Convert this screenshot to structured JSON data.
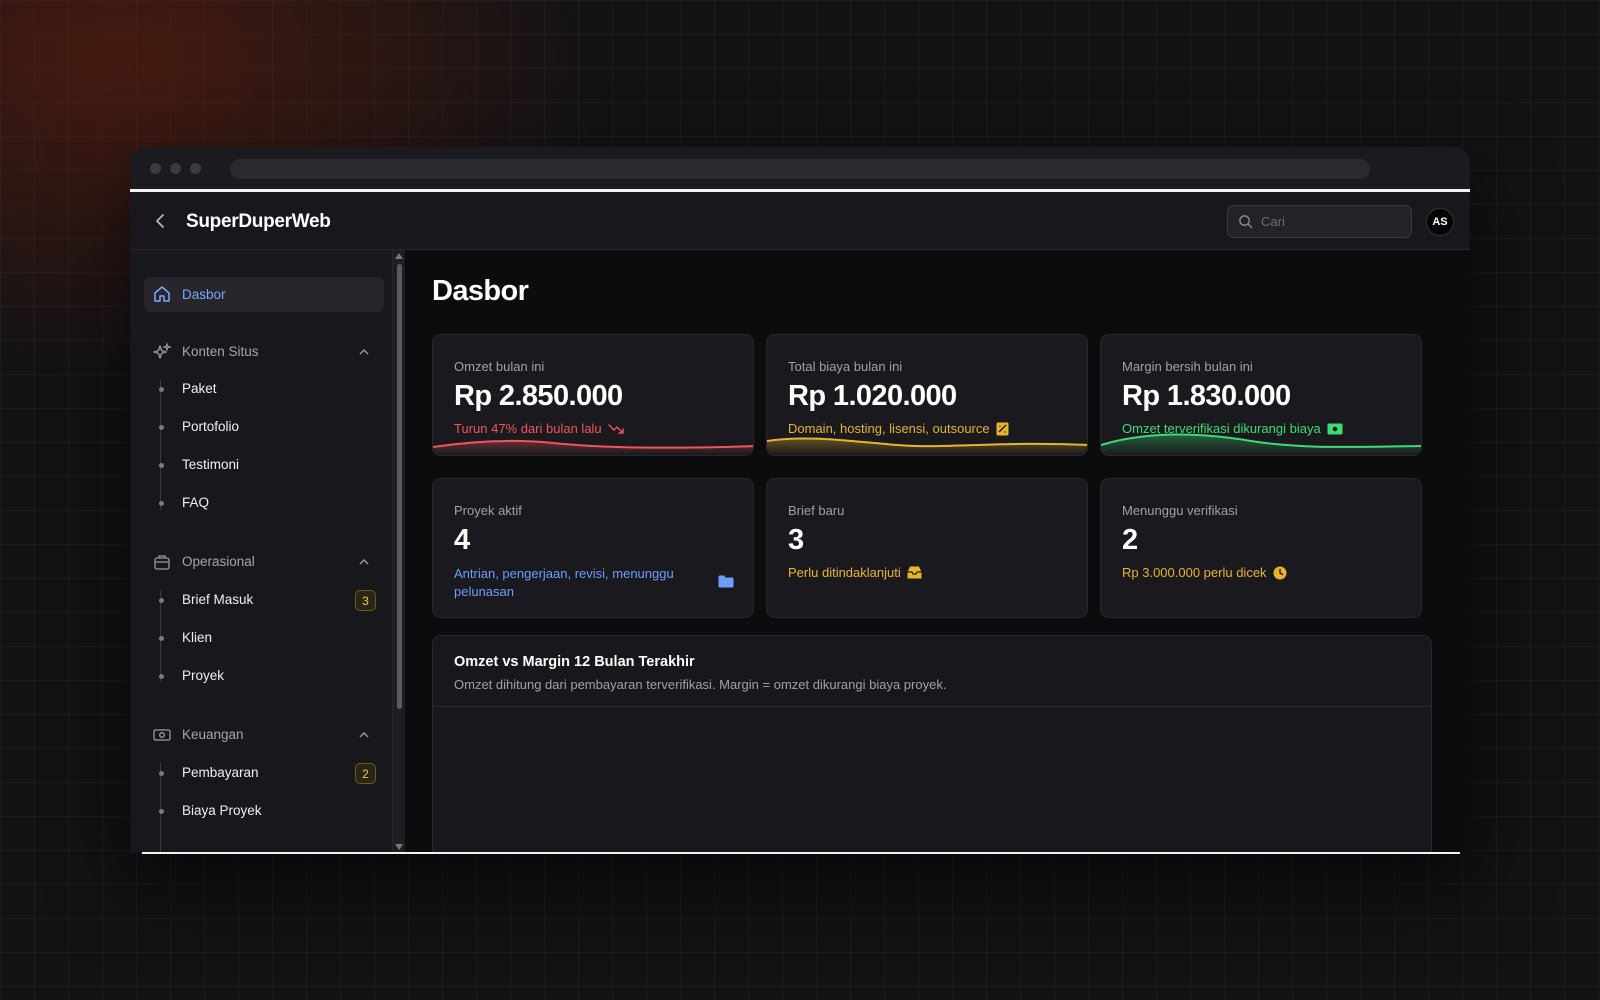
{
  "app": {
    "brand": "SuperDuperWeb",
    "search_placeholder": "Cari",
    "avatar_initials": "AS"
  },
  "sidebar": {
    "active": {
      "label": "Dasbor",
      "icon": "home-icon"
    },
    "groups": [
      {
        "label": "Konten Situs",
        "icon": "sparkles-icon",
        "items": [
          {
            "label": "Paket"
          },
          {
            "label": "Portofolio"
          },
          {
            "label": "Testimoni"
          },
          {
            "label": "FAQ"
          }
        ]
      },
      {
        "label": "Operasional",
        "icon": "briefcase-icon",
        "items": [
          {
            "label": "Brief Masuk",
            "badge": "3"
          },
          {
            "label": "Klien"
          },
          {
            "label": "Proyek"
          }
        ]
      },
      {
        "label": "Keuangan",
        "icon": "money-icon",
        "items": [
          {
            "label": "Pembayaran",
            "badge": "2"
          },
          {
            "label": "Biaya Proyek"
          }
        ]
      }
    ]
  },
  "main": {
    "title": "Dasbor",
    "cards": [
      {
        "label": "Omzet bulan ini",
        "value": "Rp 2.850.000",
        "sub": "Turun 47% dari bulan lalu",
        "color": "#f0555b",
        "icon": "trending-down-icon"
      },
      {
        "label": "Total biaya bulan ini",
        "value": "Rp 1.020.000",
        "sub": "Domain, hosting, lisensi, outsource",
        "color": "#e7b52c",
        "icon": "receipt-icon"
      },
      {
        "label": "Margin bersih bulan ini",
        "value": "Rp 1.830.000",
        "sub": "Omzet terverifikasi dikurangi biaya",
        "color": "#3ddc77",
        "icon": "cash-icon"
      },
      {
        "label": "Proyek aktif",
        "value": "4",
        "sub": "Antrian, pengerjaan, revisi, menunggu pelunasan",
        "color": "#6c9dff",
        "icon": "folder-icon"
      },
      {
        "label": "Brief baru",
        "value": "3",
        "sub": "Perlu ditindaklanjuti",
        "color": "#e7b52c",
        "icon": "inbox-icon"
      },
      {
        "label": "Menunggu verifikasi",
        "value": "2",
        "sub": "Rp 3.000.000 perlu dicek",
        "color": "#e7b52c",
        "icon": "clock-icon"
      }
    ],
    "chart": {
      "title": "Omzet vs Margin 12 Bulan Terakhir",
      "subtitle": "Omzet dihitung dari pembayaran terverifikasi. Margin = omzet dikurangi biaya proyek."
    }
  }
}
